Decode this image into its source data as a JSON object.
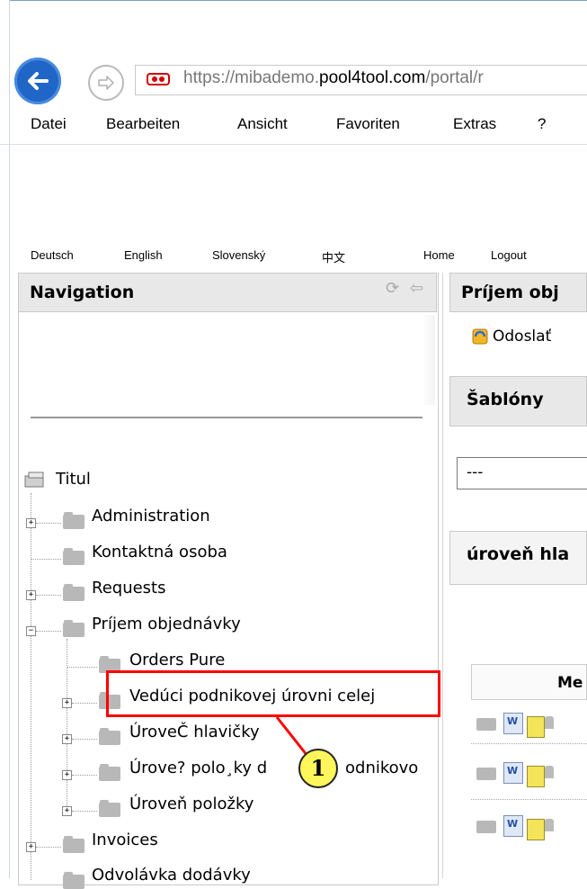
{
  "browser": {
    "url_host_prefix": "https://",
    "url_host_sub": "mibademo.",
    "url_host_domain": "pool4tool.com",
    "url_path": "/portal/r",
    "menu": [
      "Datei",
      "Bearbeiten",
      "Ansicht",
      "Favoriten",
      "Extras",
      "?"
    ]
  },
  "langbar": [
    "Deutsch",
    "English",
    "Slovenský",
    "中文",
    "Home",
    "Logout"
  ],
  "nav": {
    "title": "Navigation",
    "root": "Titul",
    "items": [
      {
        "label": "Administration"
      },
      {
        "label": "Kontaktná osoba"
      },
      {
        "label": "Requests"
      },
      {
        "label": "Príjem objednávky"
      },
      {
        "label": "Orders Pure"
      },
      {
        "label": "Vedúci podnikovej úrovni celej"
      },
      {
        "label": "ÚroveČ hlavičky"
      },
      {
        "label": "Úrove? polo¸ky d"
      },
      {
        "label": "odnikovo"
      },
      {
        "label": "Úroveň položky"
      },
      {
        "label": "Invoices"
      },
      {
        "label": "Odvolávka dodávky"
      }
    ]
  },
  "callout": {
    "number": "1"
  },
  "right": {
    "panel_title": "Príjem obj",
    "send_label": "Odoslať",
    "templates_title": "Šablóny",
    "templates_value": "---",
    "level_title": "úroveň hla",
    "table_header": "Me"
  }
}
